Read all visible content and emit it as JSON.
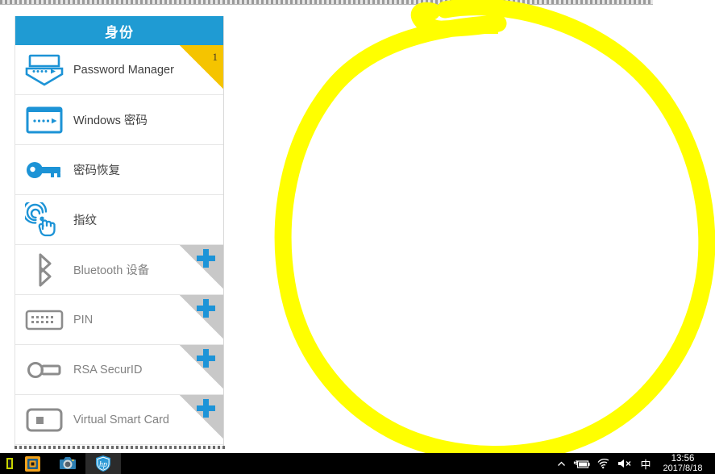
{
  "panel": {
    "header_title": "身份",
    "rows": [
      {
        "label": "Password Manager",
        "icon": "password-manager-icon",
        "state": "enabled",
        "badge": "count",
        "badge_value": "1"
      },
      {
        "label": "Windows 密码",
        "icon": "windows-password-icon",
        "state": "enabled",
        "badge": "none",
        "badge_value": ""
      },
      {
        "label": "密码恢复",
        "icon": "password-recovery-key-icon",
        "state": "enabled",
        "badge": "none",
        "badge_value": ""
      },
      {
        "label": "指纹",
        "icon": "fingerprint-icon",
        "state": "enabled",
        "badge": "none",
        "badge_value": ""
      },
      {
        "label": "Bluetooth 设备",
        "icon": "bluetooth-icon",
        "state": "disabled",
        "badge": "plus",
        "badge_value": "+"
      },
      {
        "label": "PIN",
        "icon": "pin-keypad-icon",
        "state": "disabled",
        "badge": "plus",
        "badge_value": "+"
      },
      {
        "label": "RSA SecurID",
        "icon": "rsa-securid-token-icon",
        "state": "disabled",
        "badge": "plus",
        "badge_value": "+"
      },
      {
        "label": "Virtual Smart Card",
        "icon": "virtual-smart-card-icon",
        "state": "disabled",
        "badge": "plus",
        "badge_value": "+"
      }
    ]
  },
  "annotation": {
    "type": "highlighter-ellipse",
    "color": "#ffff00"
  },
  "taskbar": {
    "apps": [
      {
        "name": "taskbar-app-partial",
        "active": false
      },
      {
        "name": "taskbar-app-explorer",
        "active": false
      },
      {
        "name": "taskbar-app-camera",
        "active": false
      },
      {
        "name": "taskbar-app-hp-client-security",
        "active": true
      }
    ],
    "tray": {
      "show_hidden_icons": "^",
      "battery": "battery-charging-icon",
      "network": "wifi-icon",
      "volume": "speaker-muted-icon",
      "ime": "中"
    },
    "clock": {
      "time": "13:56",
      "date": "2017/8/18"
    }
  },
  "colors": {
    "header_blue": "#1f9bd3",
    "accent_blue": "#1d94d8",
    "badge_yellow": "#f5c400",
    "badge_gray": "#c8c8c8",
    "highlighter_yellow": "#ffff00",
    "taskbar_black": "#000000"
  }
}
